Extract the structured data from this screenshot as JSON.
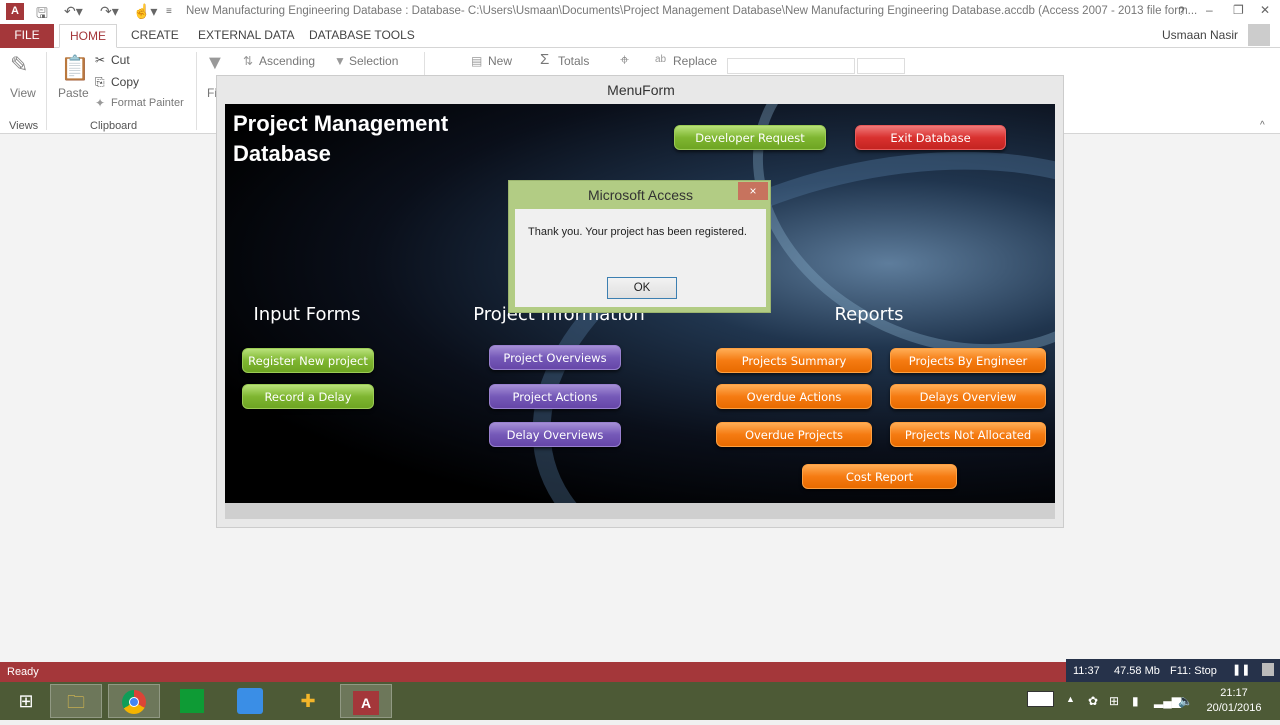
{
  "window": {
    "title": "New Manufacturing Engineering Database : Database- C:\\Users\\Usmaan\\Documents\\Project Management Database\\New Manufacturing Engineering Database.accdb (Access 2007 - 2013 file form...",
    "user": "Usmaan Nasir",
    "app_icon": "A"
  },
  "tabs": [
    {
      "label": "FILE"
    },
    {
      "label": "HOME"
    },
    {
      "label": "CREATE"
    },
    {
      "label": "EXTERNAL DATA"
    },
    {
      "label": "DATABASE TOOLS"
    }
  ],
  "ribbon": {
    "view": "View",
    "views_group": "Views",
    "paste": "Paste",
    "cut": "Cut",
    "copy": "Copy",
    "format_painter": "Format Painter",
    "clipboard_group": "Clipboard",
    "filter": "Fi",
    "ascending": "Ascending",
    "selection": "Selection",
    "new": "New",
    "totals": "Totals",
    "replace": "Replace"
  },
  "form": {
    "title": "MenuForm",
    "heading_line1": "Project Management",
    "heading_line2": "Database",
    "top_buttons": {
      "developer_request": "Developer Request",
      "exit": "Exit Database"
    },
    "sections": {
      "input": "Input Forms",
      "info": "Project Information",
      "reports": "Reports"
    },
    "input_buttons": [
      "Register New project",
      "Record a Delay"
    ],
    "info_buttons": [
      "Project Overviews",
      "Project Actions",
      "Delay Overviews"
    ],
    "report_buttons": [
      "Projects Summary",
      "Overdue Actions",
      "Overdue Projects",
      "Projects By Engineer",
      "Delays Overview",
      "Projects Not Allocated",
      "Cost Report"
    ]
  },
  "dialog": {
    "title": "Microsoft Access",
    "message": "Thank you. Your project has been registered.",
    "ok": "OK",
    "close": "×"
  },
  "status": {
    "text": "Ready"
  },
  "recorder": {
    "time": "11:37",
    "size": "47.58 Mb",
    "stop": "F11: Stop"
  },
  "clock": {
    "time": "21:17",
    "date": "20/01/2016"
  },
  "colors": {
    "access_red": "#a4373a",
    "green": "#7fb631",
    "red": "#d9312f",
    "purple": "#7559b8",
    "orange": "#f57b12"
  }
}
